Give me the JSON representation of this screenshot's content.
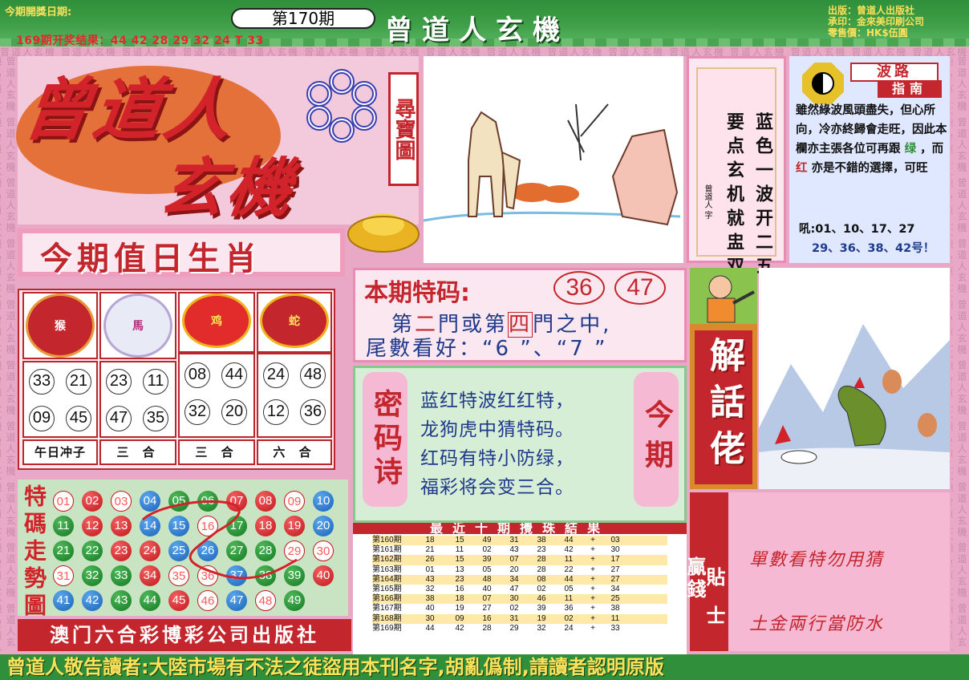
{
  "header": {
    "pub_date_label": "今期開獎日期:",
    "issue": "第170期",
    "banner_title": "曾道人玄機",
    "prev_result": "169期开奖结果：44 42 28 29 32 24 T 33",
    "publisher": [
      "出版：曾道人出版社",
      "承印：金來美印刷公司",
      "零售價：HK$伍圓"
    ]
  },
  "watermark": "曾道人玄機",
  "logo": {
    "main": "曾道人",
    "sub": "玄機",
    "treasure": "尋寶圖"
  },
  "zodiac": {
    "title": "今期值日生肖",
    "animals": [
      {
        "label": "猴",
        "numbers": [
          "33",
          "21",
          "09",
          "45"
        ],
        "relation": "午日冲子"
      },
      {
        "label": "馬",
        "numbers": [
          "23",
          "11",
          "47",
          "35"
        ],
        "relation": "三 合"
      },
      {
        "label": "鸡",
        "numbers": [
          "08",
          "44",
          "32",
          "20"
        ],
        "relation": "三 合"
      },
      {
        "label": "蛇",
        "numbers": [
          "24",
          "48",
          "12",
          "36"
        ],
        "relation": "六 合"
      }
    ]
  },
  "trend": {
    "title": "特碼走勢圖",
    "balls": [
      [
        "01",
        "02",
        "03",
        "04",
        "05",
        "06",
        "07",
        "08",
        "09",
        "10"
      ],
      [
        "11",
        "12",
        "13",
        "14",
        "15",
        "16",
        "17",
        "18",
        "19",
        "20"
      ],
      [
        "21",
        "22",
        "23",
        "24",
        "25",
        "26",
        "27",
        "28",
        "29",
        "30"
      ],
      [
        "31",
        "32",
        "33",
        "34",
        "35",
        "36",
        "37",
        "38",
        "39",
        "40"
      ],
      [
        "41",
        "42",
        "43",
        "44",
        "45",
        "46",
        "47",
        "48",
        "49"
      ]
    ],
    "colors": [
      [
        "red",
        "red",
        "blue",
        "blue",
        "green",
        "green",
        "red",
        "red",
        "blue",
        "blue"
      ],
      [
        "green",
        "red",
        "red",
        "blue",
        "blue",
        "green",
        "green",
        "red",
        "red",
        "blue"
      ],
      [
        "green",
        "green",
        "red",
        "red",
        "blue",
        "blue",
        "green",
        "green",
        "red",
        "red"
      ],
      [
        "blue",
        "green",
        "green",
        "red",
        "red",
        "blue",
        "blue",
        "green",
        "green",
        "red"
      ],
      [
        "blue",
        "blue",
        "green",
        "green",
        "red",
        "red",
        "blue",
        "blue",
        "green"
      ]
    ],
    "highlight_text": [
      "01",
      "03",
      "09",
      "16",
      "29",
      "30",
      "31",
      "35",
      "36",
      "46",
      "48"
    ]
  },
  "footer_left": "澳门六合彩博彩公司出版社",
  "poem_box": {
    "col1": "蓝色一波开二五",
    "col2": "要点玄机就盅双",
    "sign": "曾道人 字"
  },
  "guide": {
    "title1": "波路",
    "title2": "指南",
    "text_a": "雖然綠波風頭盡失，但心所向，冷亦終歸會走旺，因此本欄亦主張各位可再跟",
    "green_word": "绿",
    "text_b": "，而",
    "red_word": "红",
    "text_c": "亦是不錯的選擇，可旺",
    "nums_a": "吼:01、10、17、27",
    "nums_b": "29、36、38、42号！"
  },
  "special": {
    "title": "本期特码:",
    "num1": "36",
    "num2": "47",
    "line1_a": "第",
    "line1_b": "二",
    "line1_c": "門或第",
    "line1_d": "四",
    "line1_e": "門之中,",
    "line2": "尾數看好：“6 ”、“7 ”"
  },
  "secret_poem": {
    "left_label": "密码诗",
    "right_label": "今期",
    "lines": [
      "蓝红特波红红特，",
      "龙狗虎中猜特码。",
      "红码有特小防绿，",
      "福彩将会变三合。"
    ]
  },
  "results": {
    "title": "最近十期攪珠結果",
    "rows": [
      [
        "第160期",
        "18",
        "15",
        "49",
        "31",
        "38",
        "44",
        "+",
        "03"
      ],
      [
        "第161期",
        "21",
        "11",
        "02",
        "43",
        "23",
        "42",
        "+",
        "30"
      ],
      [
        "第162期",
        "26",
        "15",
        "39",
        "07",
        "28",
        "11",
        "+",
        "17"
      ],
      [
        "第163期",
        "01",
        "13",
        "05",
        "20",
        "28",
        "22",
        "+",
        "27"
      ],
      [
        "第164期",
        "43",
        "23",
        "48",
        "34",
        "08",
        "44",
        "+",
        "27"
      ],
      [
        "第165期",
        "32",
        "16",
        "40",
        "47",
        "02",
        "05",
        "+",
        "34"
      ],
      [
        "第166期",
        "38",
        "18",
        "07",
        "30",
        "46",
        "11",
        "+",
        "25"
      ],
      [
        "第167期",
        "40",
        "19",
        "27",
        "02",
        "39",
        "36",
        "+",
        "38"
      ],
      [
        "第168期",
        "30",
        "09",
        "16",
        "31",
        "19",
        "02",
        "+",
        "11"
      ],
      [
        "第169期",
        "44",
        "42",
        "28",
        "29",
        "32",
        "24",
        "+",
        "33"
      ]
    ]
  },
  "jieshua": "解話佬",
  "tips": {
    "bar1": "贏錢",
    "bar2": "貼士",
    "line1": "單數看特勿用猜",
    "line2": "土金兩行當防水"
  },
  "bottom_notice": "曾道人敬告讀者:大陸市場有不法之徒盜用本刊名字,胡亂僞制,請讀者認明原版"
}
